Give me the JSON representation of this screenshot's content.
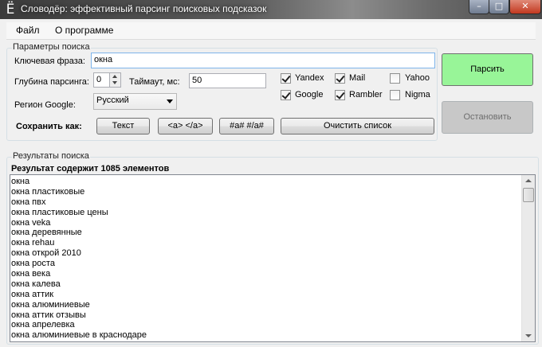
{
  "window": {
    "icon_glyph": "Ё",
    "title": "Словодёр: эффективный парсинг поисковых подсказок",
    "controls": {
      "minimize": "–",
      "maximize": "□",
      "close": "✕"
    }
  },
  "menu": {
    "file": "Файл",
    "about": "О программе"
  },
  "params": {
    "group_title": "Параметры поиска",
    "keyword_label": "Ключевая фраза:",
    "keyword_value": "окна",
    "depth_label": "Глубина парсинга:",
    "depth_value": "0",
    "timeout_label": "Таймаут, мс:",
    "timeout_value": "50",
    "region_label": "Регион Google:",
    "region_value": "Русский"
  },
  "engines": [
    {
      "label": "Yandex",
      "checked": true
    },
    {
      "label": "Mail",
      "checked": true
    },
    {
      "label": "Yahoo",
      "checked": false
    },
    {
      "label": "Google",
      "checked": true
    },
    {
      "label": "Rambler",
      "checked": true
    },
    {
      "label": "Nigma",
      "checked": false
    }
  ],
  "save": {
    "label": "Сохранить как:",
    "text_btn": "Текст",
    "link_btn": "<a> </a>",
    "hash_btn": "#a# #/a#",
    "clear_btn": "Очистить список"
  },
  "actions": {
    "parse": "Парсить",
    "stop": "Остановить"
  },
  "results": {
    "group_title": "Результаты поиска",
    "count_text": "Результат содержит 1085 элементов",
    "items": [
      "окна",
      "окна пластиковые",
      "окна пвх",
      "окна пластиковые цены",
      "окна veka",
      "окна деревянные",
      "окна rehau",
      "окна открой 2010",
      "окна роста",
      "окна века",
      "окна калева",
      "окна аттик",
      "окна алюминиевые",
      "окна аттик отзывы",
      "окна апрелевка",
      "окна алюминиевые в краснодаре"
    ]
  }
}
